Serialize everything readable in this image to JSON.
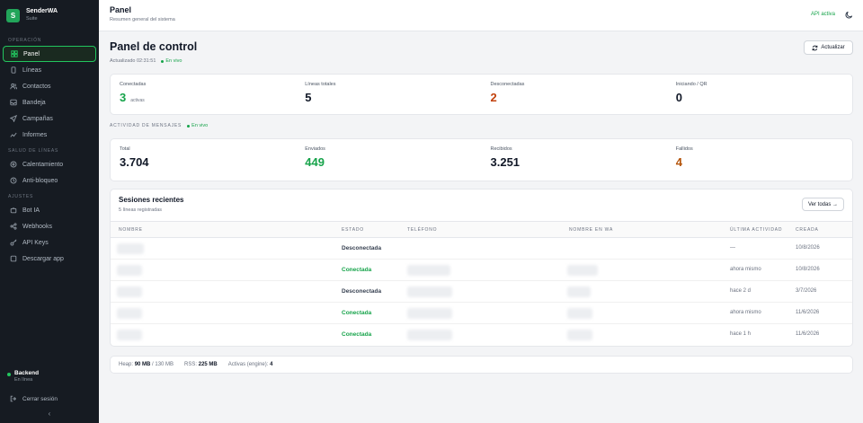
{
  "brand": {
    "initial": "S",
    "name": "SenderWA",
    "sub": "Suite"
  },
  "sidebar": {
    "sections": [
      {
        "label": "OPERACIÓN"
      },
      {
        "label": "SALUD DE LÍNEAS"
      },
      {
        "label": "AJUSTES"
      }
    ],
    "items": [
      {
        "label": "Panel",
        "icon": "grid-icon"
      },
      {
        "label": "Líneas",
        "icon": "phone-icon"
      },
      {
        "label": "Contactos",
        "icon": "users-icon"
      },
      {
        "label": "Bandeja",
        "icon": "inbox-icon"
      },
      {
        "label": "Campañas",
        "icon": "send-icon"
      },
      {
        "label": "Informes",
        "icon": "chart-icon"
      },
      {
        "label": "Calentamiento",
        "icon": "flame-icon"
      },
      {
        "label": "Anti-bloqueo",
        "icon": "shield-icon"
      },
      {
        "label": "Bot IA",
        "icon": "bot-icon"
      },
      {
        "label": "Webhooks",
        "icon": "share-icon"
      },
      {
        "label": "API Keys",
        "icon": "key-icon"
      },
      {
        "label": "Descargar app",
        "icon": "download-icon"
      }
    ],
    "backend": {
      "title": "Backend",
      "status": "En línea"
    },
    "logout": "Cerrar sesión",
    "collapse": "‹"
  },
  "topbar": {
    "title": "Panel",
    "subtitle": "Resumen general del sistema",
    "api_status": "API activa"
  },
  "main": {
    "title": "Panel de control",
    "updated": "Actualizado 02:31:51",
    "live": "En vivo",
    "refresh": "Actualizar",
    "lines_stats": [
      {
        "label": "Conectadas",
        "value": "3",
        "suffix": "activas"
      },
      {
        "label": "Líneas totales",
        "value": "5"
      },
      {
        "label": "Desconectadas",
        "value": "2"
      },
      {
        "label": "Iniciando / QR",
        "value": "0"
      }
    ],
    "activity_label": "ACTIVIDAD DE MENSAJES",
    "message_stats": [
      {
        "label": "Total",
        "value": "3.704"
      },
      {
        "label": "Enviados",
        "value": "449"
      },
      {
        "label": "Recibidos",
        "value": "3.251"
      },
      {
        "label": "Fallidos",
        "value": "4"
      }
    ],
    "sessions": {
      "title": "Sesiones recientes",
      "subtitle": "5 líneas registradas",
      "view_all": "Ver todas →",
      "columns": [
        "NOMBRE",
        "ESTADO",
        "TELÉFONO",
        "NOMBRE EN WA",
        "ÚLTIMA ACTIVIDAD",
        "CREADA"
      ],
      "rows": [
        {
          "estado": "Desconectada",
          "ultima": "—",
          "creada": "10/8/2026"
        },
        {
          "estado": "Conectada",
          "ultima": "ahora mismo",
          "creada": "10/8/2026"
        },
        {
          "estado": "Desconectada",
          "ultima": "hace 2 d",
          "creada": "3/7/2026"
        },
        {
          "estado": "Conectada",
          "ultima": "ahora mismo",
          "creada": "11/6/2026"
        },
        {
          "estado": "Conectada",
          "ultima": "hace 1 h",
          "creada": "11/6/2026"
        }
      ]
    },
    "footer": {
      "heap_label": "Heap:",
      "heap_value": "90 MB",
      "heap_total": "/ 130 MB",
      "rss_label": "RSS:",
      "rss_value": "225 MB",
      "active_label": "Activas (engine):",
      "active_value": "4"
    }
  },
  "colors": {
    "accent": "#22c55e",
    "sidebar": "#161b22",
    "connected": "#16a34a",
    "disconnected": "#c2410c",
    "failed": "#b45309"
  }
}
